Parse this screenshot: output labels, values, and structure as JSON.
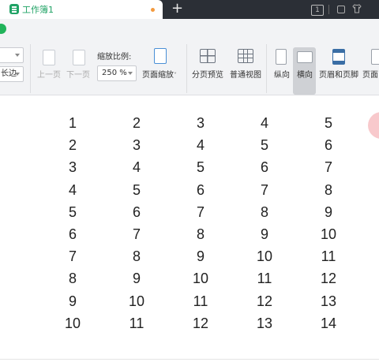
{
  "tab": {
    "title": "工作簿1"
  },
  "titlebar": {
    "new_tab": "+",
    "window_count": "1"
  },
  "ribbon": {
    "left_field_value": "",
    "orientation_field_value": "长边",
    "prev_page_label": "上一页",
    "next_page_label": "下一页",
    "zoom_label": "缩放比例:",
    "zoom_value": "250 %",
    "page_zoom_label": "页面缩放",
    "page_zoom_caret": "˅",
    "page_break_preview_label": "分页预览",
    "normal_view_label": "普通视图",
    "portrait_label": "纵向",
    "landscape_label": "横向",
    "header_footer_label": "页眉和页脚",
    "page_setup_label": "页面"
  },
  "table": {
    "rows": [
      [
        "1",
        "2",
        "3",
        "4",
        "5"
      ],
      [
        "2",
        "3",
        "4",
        "5",
        "6"
      ],
      [
        "3",
        "4",
        "5",
        "6",
        "7"
      ],
      [
        "4",
        "5",
        "6",
        "7",
        "8"
      ],
      [
        "5",
        "6",
        "7",
        "8",
        "9"
      ],
      [
        "6",
        "7",
        "8",
        "9",
        "10"
      ],
      [
        "7",
        "8",
        "9",
        "10",
        "11"
      ],
      [
        "8",
        "9",
        "10",
        "11",
        "12"
      ],
      [
        "9",
        "10",
        "11",
        "12",
        "13"
      ],
      [
        "10",
        "11",
        "12",
        "13",
        "14"
      ]
    ]
  },
  "colors": {
    "accent_green": "#21a366",
    "titlebar_bg": "#2b2f36",
    "ribbon_bg": "#f2f3f5",
    "modified_dot": "#f39a3f"
  }
}
